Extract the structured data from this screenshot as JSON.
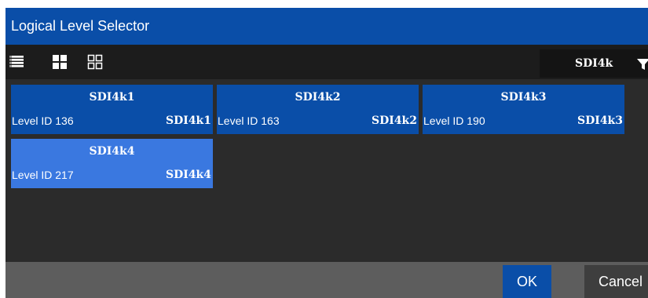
{
  "window": {
    "title": "Logical Level Selector"
  },
  "toolbar": {
    "view_icons": [
      "list-view-icon",
      "large-tile-view-icon",
      "small-tile-view-icon"
    ],
    "filter": {
      "value": "SDI4k",
      "icon": "filter-funnel-icon"
    }
  },
  "levels": [
    {
      "name": "SDI4k1",
      "level": "Level ID 136",
      "tag": "SDI4k1",
      "selected": false
    },
    {
      "name": "SDI4k2",
      "level": "Level ID 163",
      "tag": "SDI4k2",
      "selected": false
    },
    {
      "name": "SDI4k3",
      "level": "Level ID 190",
      "tag": "SDI4k3",
      "selected": false
    },
    {
      "name": "SDI4k4",
      "level": "Level ID 217",
      "tag": "SDI4k4",
      "selected": true
    }
  ],
  "footer": {
    "ok_label": "OK",
    "cancel_label": "Cancel"
  },
  "colors": {
    "accent": "#0a4ea8",
    "selected": "#3a78e0",
    "panel": "#2b2b2b",
    "toolbar": "#1c1c1c",
    "footer": "#5d5d5d"
  }
}
